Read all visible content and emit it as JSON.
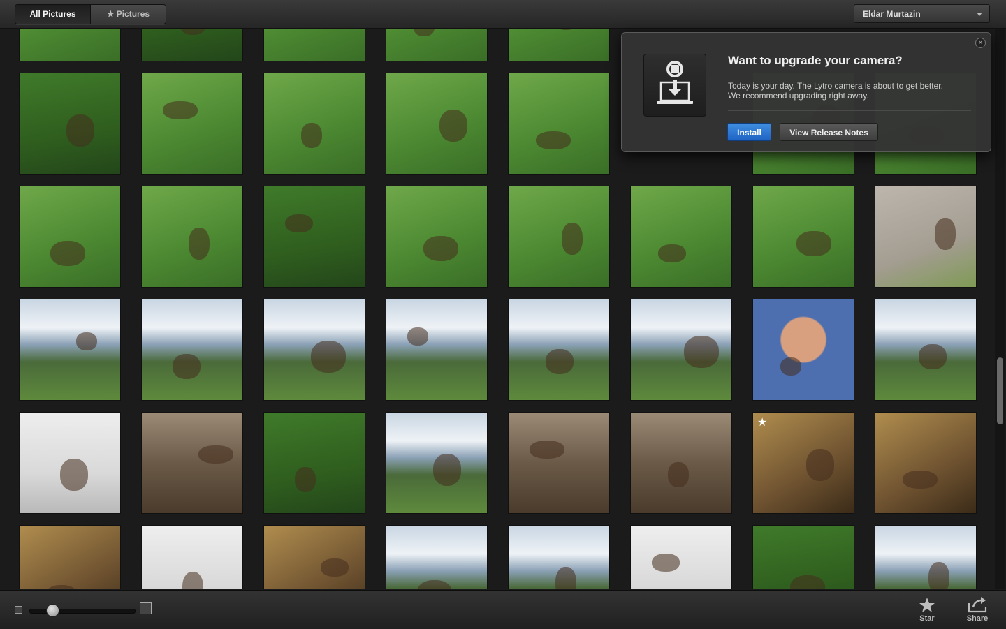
{
  "toolbar": {
    "tabs": [
      {
        "label": "All Pictures",
        "active": true
      },
      {
        "label": "Pictures",
        "starred": true,
        "active": false
      }
    ],
    "user_menu": {
      "label": "Eldar Murtazin",
      "icon": "chevron-down-icon"
    }
  },
  "upgrade_popup": {
    "title": "Want to upgrade your camera?",
    "message_line1": "Today is your day.  The Lytro camera is about to get better.",
    "message_line2": "We recommend upgrading right away.",
    "install_label": "Install",
    "release_notes_label": "View Release Notes",
    "icon": "camera-download-icon",
    "close_icon": "close-icon"
  },
  "gallery": {
    "thumbnail_size_slider_fraction": 0.22,
    "starred_picture": {
      "row": 4,
      "col": 6
    }
  },
  "bottom_bar": {
    "star_label": "Star",
    "share_label": "Share"
  },
  "colors": {
    "accent_install": "#2a74d4",
    "background": "#1b1b1b"
  }
}
